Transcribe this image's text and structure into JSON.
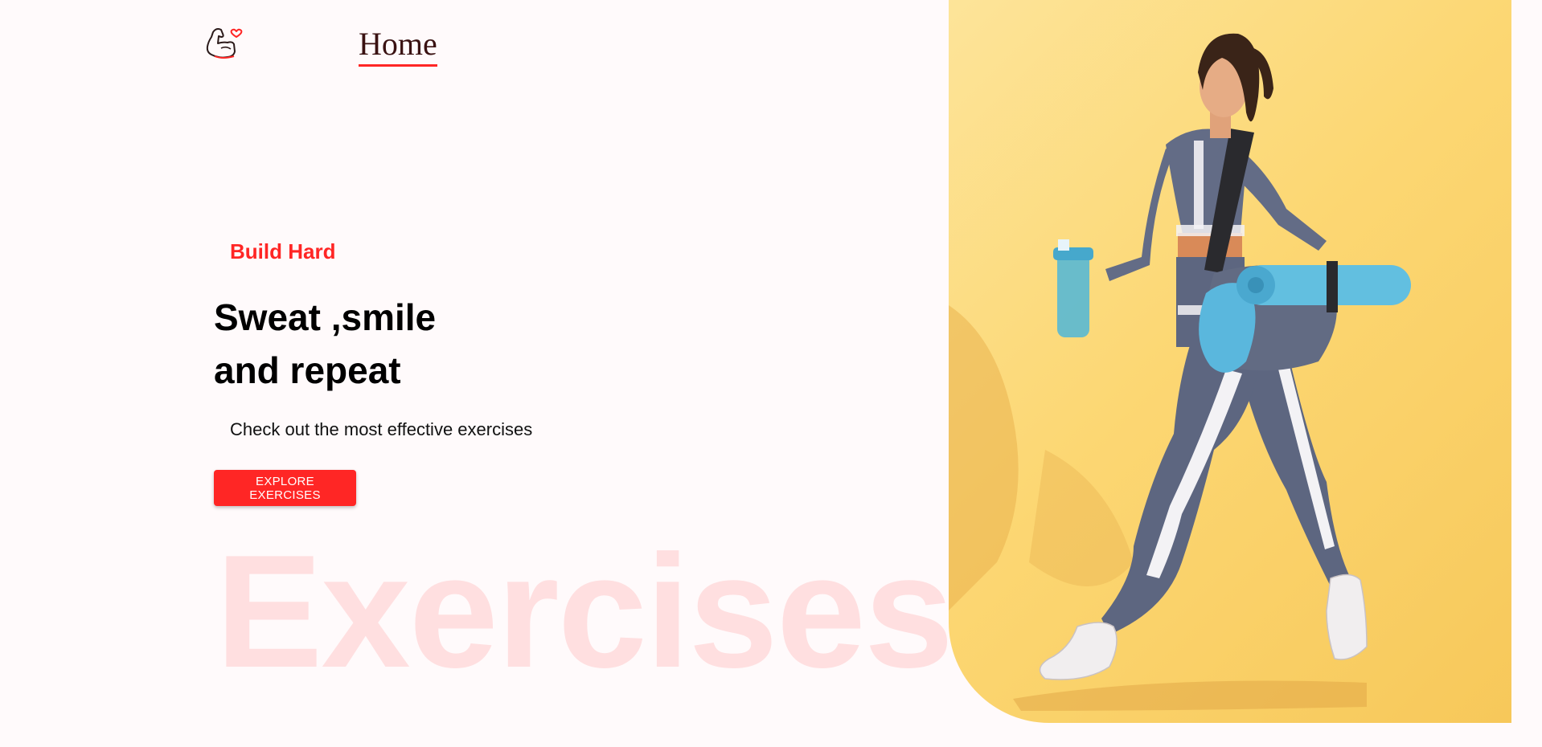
{
  "nav": {
    "logo_icon": "flexed-arm-heart-icon",
    "home_label": "Home",
    "accent_color": "#ff2625"
  },
  "hero": {
    "tagline": "Build Hard",
    "headline_line1": "Sweat ,smile",
    "headline_line2": "and repeat",
    "subtext": "Check out the most effective exercises",
    "cta_label": "EXPLORE EXERCISES",
    "watermark": "Exercises",
    "banner_image_icon": "woman-walking-with-gym-bag-photo",
    "banner_background": "#fcd773"
  }
}
